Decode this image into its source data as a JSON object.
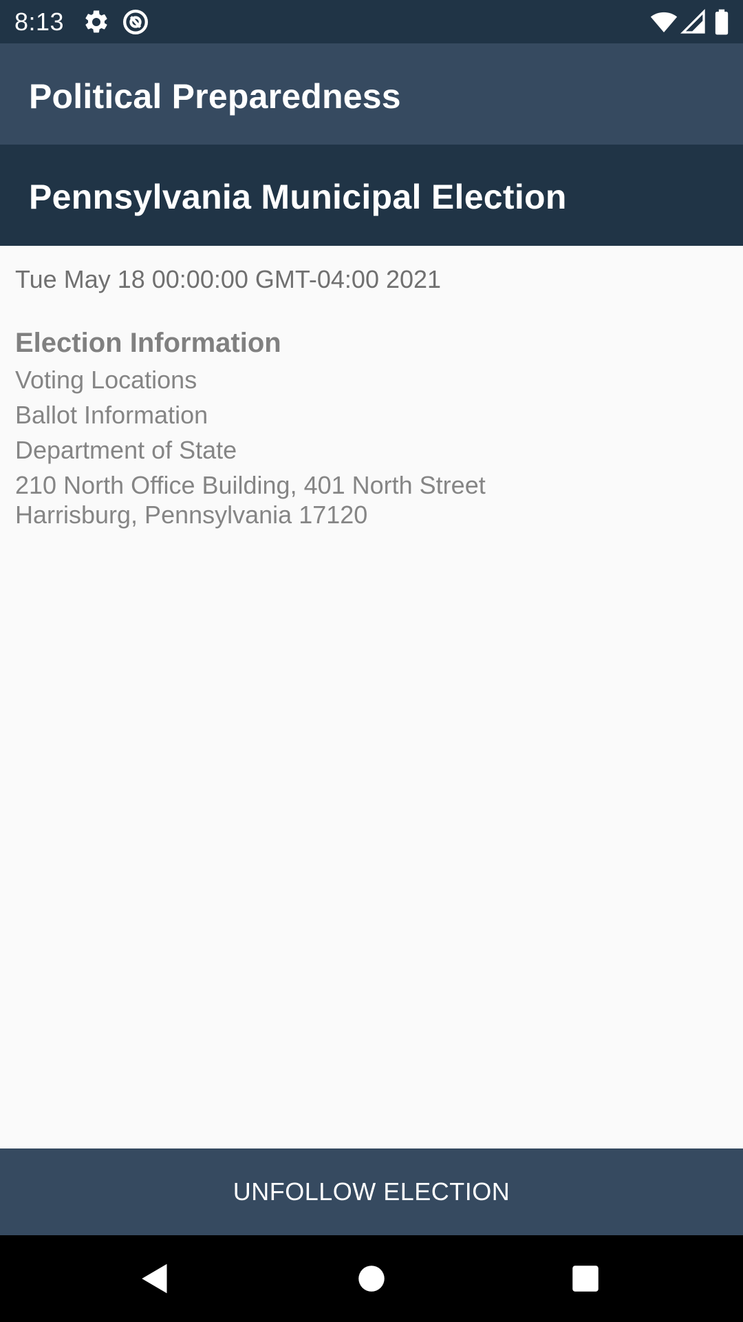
{
  "status_bar": {
    "time": "8:13",
    "icons": [
      "gear-icon",
      "at-sign-icon",
      "wifi-icon",
      "signal-icon",
      "battery-icon"
    ]
  },
  "app_bar": {
    "title": "Political Preparedness"
  },
  "election": {
    "name": "Pennsylvania Municipal Election",
    "date": "Tue May 18 00:00:00 GMT-04:00 2021"
  },
  "info": {
    "heading": "Election Information",
    "voting_locations": "Voting Locations",
    "ballot_information": "Ballot Information",
    "department": "Department of State",
    "address_line1": "210 North Office Building, 401 North Street",
    "address_line2": "Harrisburg, Pennsylvania 17120"
  },
  "actions": {
    "unfollow_label": "UNFOLLOW ELECTION"
  },
  "nav_bar": {
    "icons": [
      "back-icon",
      "home-icon",
      "recents-icon"
    ]
  },
  "colors": {
    "status_bar": "#203446",
    "primary": "#364a60",
    "primary_dark": "#203446",
    "background": "#fafafa",
    "secondary_text": "#858585"
  }
}
